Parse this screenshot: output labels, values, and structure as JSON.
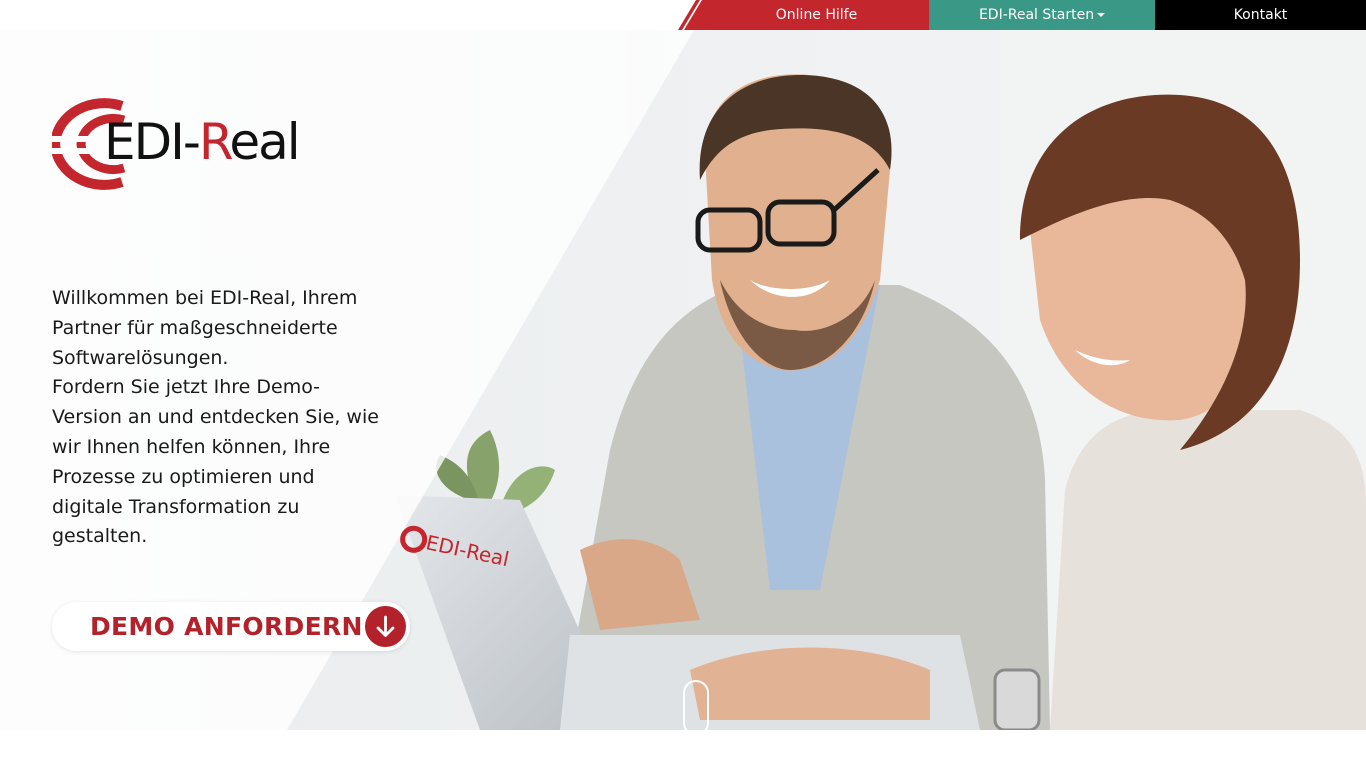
{
  "nav": {
    "online_help": "Online Hilfe",
    "start": "EDI-Real Starten",
    "contact": "Kontakt"
  },
  "logo": {
    "text_main": "EDI-",
    "text_r": "R",
    "text_rest": "eal"
  },
  "photo_laptop_logo": "EDI-Real",
  "intro": {
    "line1": "Willkommen bei EDI-Real, Ihrem Partner für maßgeschneiderte Softwarelösungen.",
    "line2": "Fordern Sie jetzt Ihre Demo-Version an und entdecken Sie, wie wir Ihnen helfen können, Ihre Prozesse zu optimieren und digitale Transformation zu gestalten."
  },
  "cta": {
    "label": "DEMO ANFORDERN"
  },
  "colors": {
    "brand_red": "#c4262e",
    "cta_red": "#b3222a",
    "teal": "#3a9886",
    "black": "#000000"
  },
  "icons": {
    "start_dropdown": "caret-down-icon",
    "cta_icon": "arrow-down-icon",
    "scroll": "mouse-scroll-icon"
  }
}
